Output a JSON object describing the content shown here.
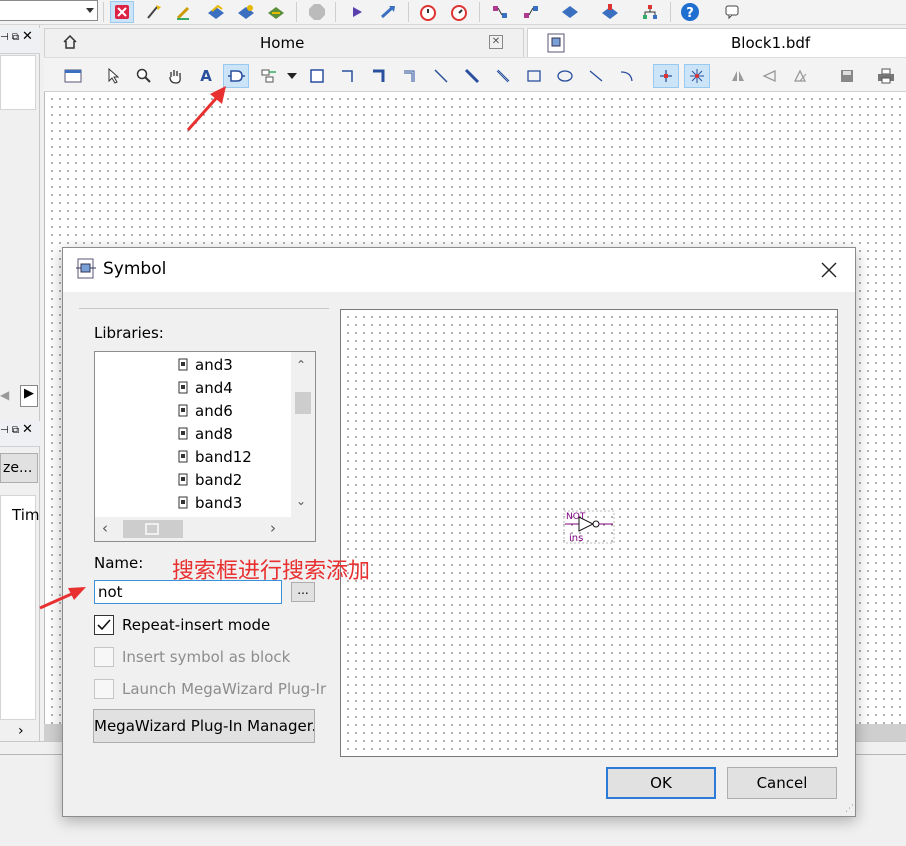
{
  "tabs": [
    {
      "label": "Home"
    },
    {
      "label": "Block1.bdf"
    }
  ],
  "left_panel": {
    "button_label": "ze...",
    "column_header": "Tim"
  },
  "dialog": {
    "title": "Symbol",
    "libraries_label": "Libraries:",
    "library_items": [
      "and3",
      "and4",
      "and6",
      "and8",
      "band12",
      "band2",
      "band3"
    ],
    "name_label": "Name:",
    "name_value": "not",
    "browse_label": "...",
    "repeat_insert": {
      "label": "Repeat-insert mode",
      "checked": true
    },
    "insert_as_block": {
      "label": "Insert symbol as block",
      "checked": false
    },
    "launch_megawizard": {
      "label": "Launch MegaWizard Plug-Ir",
      "checked": false
    },
    "megawizard_button": "MegaWizard Plug-In Manager...",
    "ok_label": "OK",
    "cancel_label": "Cancel",
    "preview": {
      "symbol_name": "NOT",
      "instance_name": "ins"
    }
  },
  "annotation": {
    "text": "搜索框进行搜索添加",
    "color": "#e83030"
  },
  "colors": {
    "accent_blue": "#2c7bd6",
    "selected_button_bg": "#cce4f7",
    "annotation_red": "#e83030",
    "symbol_purple": "#800080"
  }
}
